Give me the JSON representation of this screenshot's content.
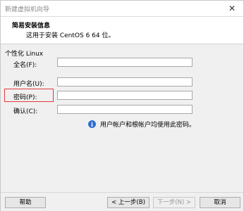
{
  "window": {
    "title": "新建虚拟机向导",
    "close_glyph": "✕"
  },
  "header": {
    "title": "简易安装信息",
    "subtitle": "这用于安装 CentOS 6 64 位。"
  },
  "group": {
    "label": "个性化 Linux"
  },
  "fields": {
    "fullname": {
      "label": "全名(F):",
      "value": ""
    },
    "username": {
      "label": "用户名(U):",
      "value": ""
    },
    "password": {
      "label": "密码(P):",
      "value": ""
    },
    "confirm": {
      "label": "确认(C):",
      "value": ""
    }
  },
  "info": {
    "icon": "i",
    "text": "用户帐户和根帐户均使用此密码。"
  },
  "buttons": {
    "help": "帮助",
    "back": "< 上一步(B)",
    "next": "下一步(N) >",
    "cancel": "取消"
  },
  "colors": {
    "highlight": "#e23a3a",
    "info_icon": "#2f6ed1"
  }
}
